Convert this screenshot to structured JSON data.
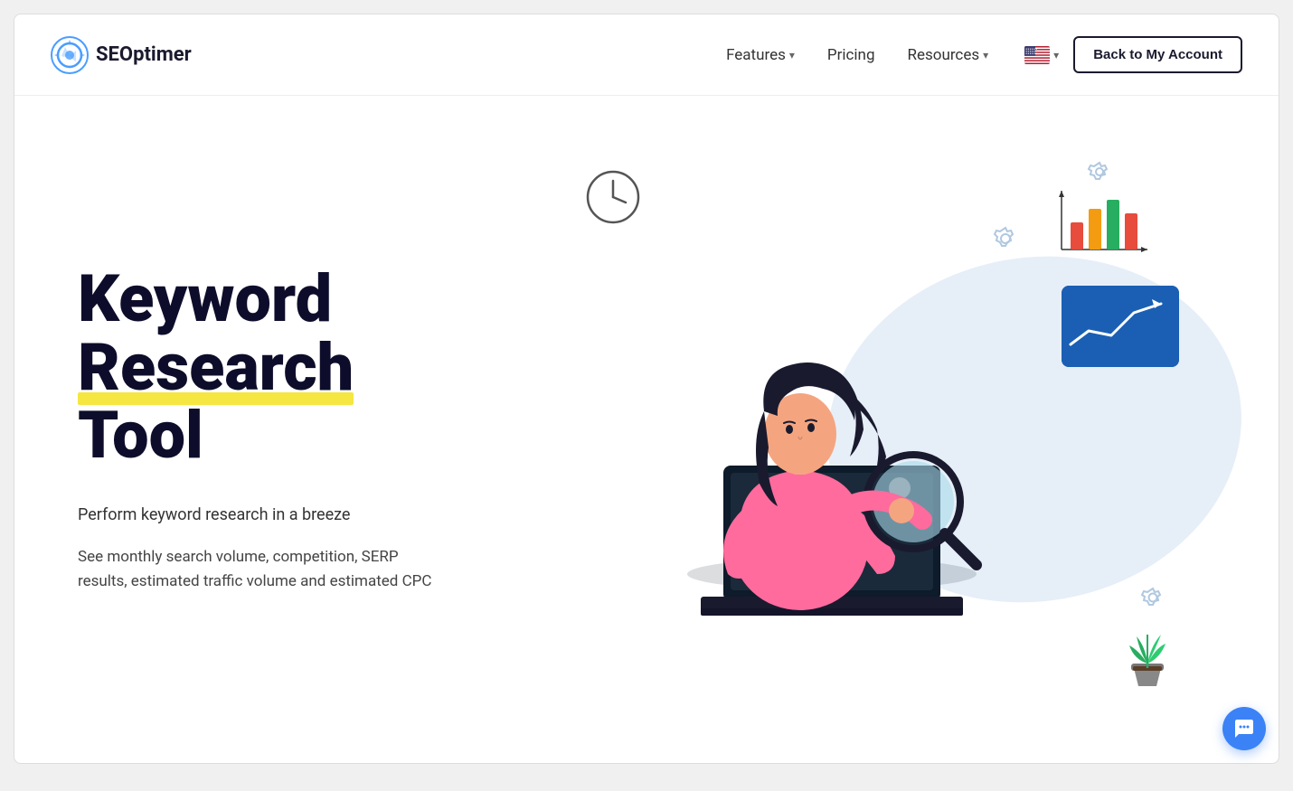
{
  "navbar": {
    "logo_text": "SEOptimer",
    "links": [
      {
        "label": "Features",
        "has_dropdown": true
      },
      {
        "label": "Pricing",
        "has_dropdown": false
      },
      {
        "label": "Resources",
        "has_dropdown": true
      }
    ],
    "back_button": "Back to My Account"
  },
  "hero": {
    "title_line1": "Keyword",
    "title_line2": "Research",
    "title_line3": "Tool",
    "subtitle": "Perform keyword research in a breeze",
    "description": "See monthly search volume, competition, SERP results, estimated traffic volume and estimated CPC"
  }
}
